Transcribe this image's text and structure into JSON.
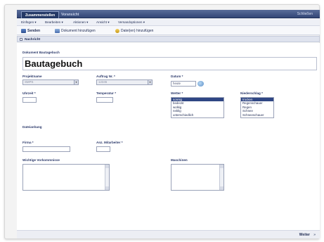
{
  "window": {
    "tabs": [
      {
        "label": "Zusammenstellen"
      },
      {
        "label": "Voransicht"
      }
    ],
    "close_label": "Schließen"
  },
  "menu": {
    "items": [
      {
        "label": "Einfügen ▾"
      },
      {
        "label": "Bearbeiten ▾"
      },
      {
        "label": "Aktionen ▾"
      },
      {
        "label": "Ansicht ▾"
      },
      {
        "label": "Versandoptionen ▾"
      }
    ]
  },
  "toolbar": {
    "send_label": "Senden",
    "add_document_label": "Dokument hinzufügen",
    "add_files_label": "Datei(en) hinzufügen"
  },
  "section": {
    "label": "Nachricht"
  },
  "form": {
    "document_type_label": "Dokument Bautagebuch",
    "document_title": "Bautagebuch",
    "project_label": "Projektname",
    "project_value": "SMPS",
    "order_label": "Auftrag Nr. *",
    "order_value": "12345",
    "date_label": "Datum *",
    "date_value": "heute",
    "time_label": "Uhrzeit *",
    "temperature_label": "Temperatur *",
    "weather_label": "Wetter *",
    "weather_options": [
      "sonnig",
      "bedeckt",
      "wolkig",
      "neblig",
      "unterschiedlich"
    ],
    "precipitation_label": "Niederschlag *",
    "precipitation_options": [
      "trocken",
      "Regenschauer",
      "Regen",
      "Schnee",
      "Schneeschauer"
    ],
    "attachment_label": "Dateianhang",
    "company_label": "Firma *",
    "workers_label": "Anz. Mitarbeiter *",
    "events_label": "Wichtige Vorkommnisse",
    "machines_label": "Maschinen"
  },
  "footer": {
    "next_label": "Weiter",
    "next_arrow": "»"
  }
}
